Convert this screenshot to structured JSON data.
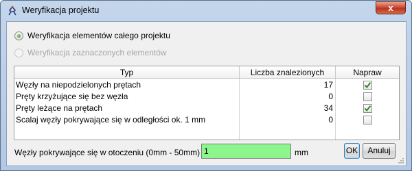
{
  "window": {
    "title": "Weryfikacja projektu",
    "close_label": "x"
  },
  "scope": {
    "option_all": "Weryfikacja elementów całego projektu",
    "option_all_selected": true,
    "option_selected": "Weryfikacja zaznaczonych elementów",
    "option_selected_enabled": false
  },
  "table": {
    "headers": [
      "Typ",
      "Liczba znalezionych",
      "Napraw"
    ],
    "rows": [
      {
        "name": "Węzły na niepodzielonych prętach",
        "count": "17",
        "fix": true
      },
      {
        "name": "Pręty krzyżujące się bez węzła",
        "count": "0",
        "fix": false
      },
      {
        "name": "Pręty leżące na prętach",
        "count": "34",
        "fix": true
      },
      {
        "name": "Scalaj węzły pokrywające się w odległości ok. 1 mm",
        "count": "0",
        "fix": false
      }
    ]
  },
  "tolerance": {
    "label": "Węzły pokrywające się w otoczeniu (0mm - 50mm)",
    "value": "1",
    "unit": "mm"
  },
  "buttons": {
    "ok": "OK",
    "cancel": "Anuluj"
  },
  "colors": {
    "input_highlight": "#8cf58c",
    "check_mark": "#2a8a1a"
  }
}
